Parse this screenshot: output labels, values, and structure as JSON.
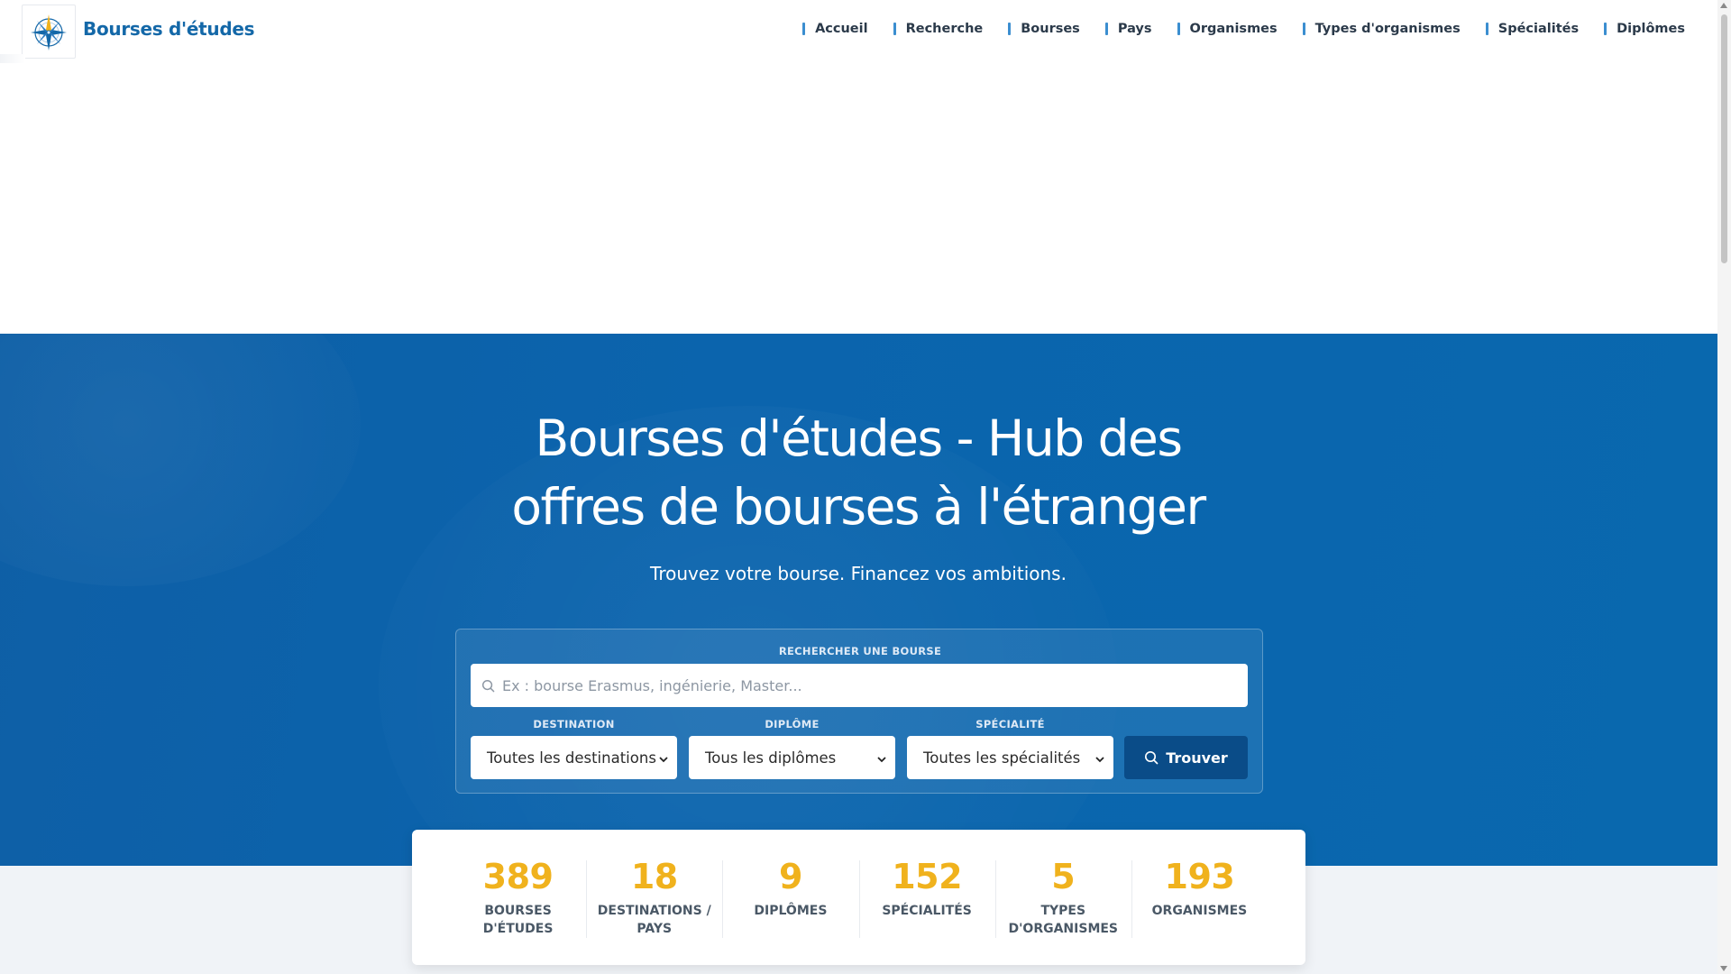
{
  "brand": {
    "name": "Bourses d'études",
    "logo_icon": "compass-rose-icon"
  },
  "nav": {
    "items": [
      {
        "label": "Accueil"
      },
      {
        "label": "Recherche"
      },
      {
        "label": "Bourses"
      },
      {
        "label": "Pays"
      },
      {
        "label": "Organismes"
      },
      {
        "label": "Types d'organismes"
      },
      {
        "label": "Spécialités"
      },
      {
        "label": "Diplômes"
      }
    ]
  },
  "hero": {
    "title_line1": "Bourses d'études - Hub des",
    "title_line2": "offres de bourses à l'étranger",
    "subtitle": "Trouvez votre bourse. Financez vos ambitions."
  },
  "search": {
    "label": "RECHERCHER UNE BOURSE",
    "placeholder": "Ex : bourse Erasmus, ingénierie, Master...",
    "destination": {
      "label": "DESTINATION",
      "value": "Toutes les destinations"
    },
    "diploma": {
      "label": "DIPLÔME",
      "value": "Tous les diplômes"
    },
    "speciality": {
      "label": "SPÉCIALITÉ",
      "value": "Toutes les spécialités"
    },
    "button_label": "Trouver"
  },
  "stats": [
    {
      "value": "389",
      "label": "BOURSES D'ÉTUDES"
    },
    {
      "value": "18",
      "label": "DESTINATIONS / PAYS"
    },
    {
      "value": "9",
      "label": "DIPLÔMES"
    },
    {
      "value": "152",
      "label": "SPÉCIALITÉS"
    },
    {
      "value": "5",
      "label": "TYPES D'ORGANISMES"
    },
    {
      "value": "193",
      "label": "ORGANISMES"
    }
  ],
  "colors": {
    "brand_blue": "#1468a8",
    "hero_blue": "#0b64ad",
    "accent_yellow": "#f0b21d",
    "button_dark_blue": "#0a4c88"
  }
}
